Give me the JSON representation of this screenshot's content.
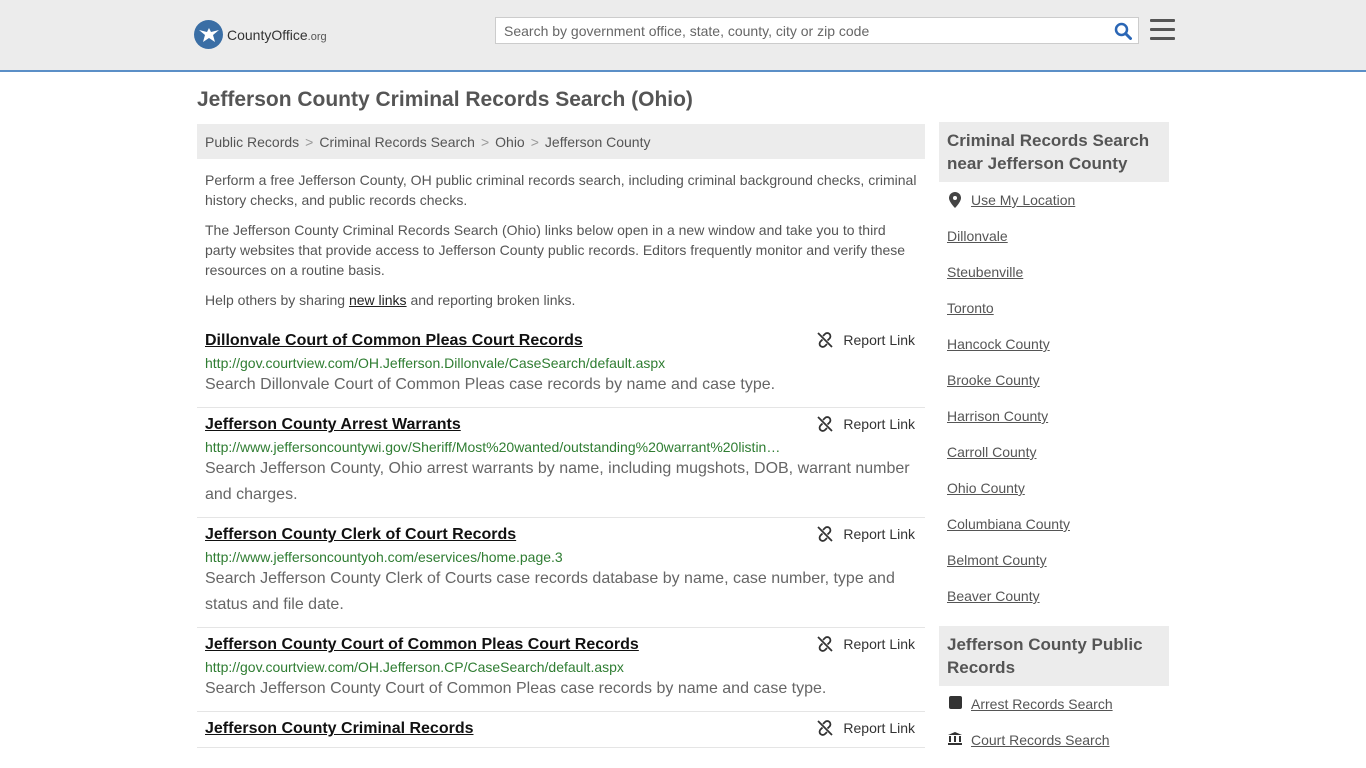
{
  "header": {
    "logo_text": "CountyOffice",
    "logo_suffix": ".org",
    "search_placeholder": "Search by government office, state, county, city or zip code"
  },
  "page": {
    "title": "Jefferson County Criminal Records Search (Ohio)"
  },
  "breadcrumb": [
    "Public Records",
    "Criminal Records Search",
    "Ohio",
    "Jefferson County"
  ],
  "intro": {
    "p1": "Perform a free Jefferson County, OH public criminal records search, including criminal background checks, criminal history checks, and public records checks.",
    "p2": "The Jefferson County Criminal Records Search (Ohio) links below open in a new window and take you to third party websites that provide access to Jefferson County public records. Editors frequently monitor and verify these resources on a routine basis.",
    "p3_before": "Help others by sharing ",
    "p3_link": "new links",
    "p3_after": " and reporting broken links."
  },
  "report_label": "Report Link",
  "results": [
    {
      "title": "Dillonvale Court of Common Pleas Court Records",
      "url": "http://gov.courtview.com/OH.Jefferson.Dillonvale/CaseSearch/default.aspx",
      "desc": "Search Dillonvale Court of Common Pleas case records by name and case type."
    },
    {
      "title": "Jefferson County Arrest Warrants",
      "url": "http://www.jeffersoncountywi.gov/Sheriff/Most%20wanted/outstanding%20warrant%20listin…",
      "desc": "Search Jefferson County, Ohio arrest warrants by name, including mugshots, DOB, warrant number and charges."
    },
    {
      "title": "Jefferson County Clerk of Court Records",
      "url": "http://www.jeffersoncountyoh.com/eservices/home.page.3",
      "desc": "Search Jefferson County Clerk of Courts case records database by name, case number, type and status and file date."
    },
    {
      "title": "Jefferson County Court of Common Pleas Court Records",
      "url": "http://gov.courtview.com/OH.Jefferson.CP/CaseSearch/default.aspx",
      "desc": "Search Jefferson County Court of Common Pleas case records by name and case type."
    },
    {
      "title": "Jefferson County Criminal Records",
      "url": "",
      "desc": ""
    }
  ],
  "sidebar": {
    "nearby_heading": "Criminal Records Search near Jefferson County",
    "use_location": "Use My Location",
    "nearby": [
      "Dillonvale",
      "Steubenville",
      "Toronto",
      "Hancock County",
      "Brooke County",
      "Harrison County",
      "Carroll County",
      "Ohio County",
      "Columbiana County",
      "Belmont County",
      "Beaver County"
    ],
    "public_heading": "Jefferson County Public Records",
    "public_links": [
      "Arrest Records Search",
      "Court Records Search"
    ]
  }
}
